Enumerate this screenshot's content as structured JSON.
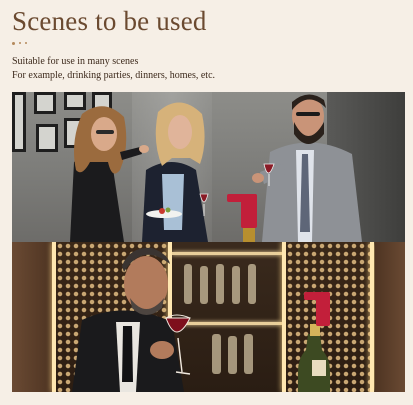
{
  "header": {
    "title": "Scenes to be used",
    "line1": "Suitable for use in many scenes",
    "line2": "For example, drinking parties, dinners, homes, etc."
  },
  "colors": {
    "background": "#f6efe6",
    "title": "#6b4a30",
    "body_text": "#3d2a1c",
    "accent_dots": "#b48a5c",
    "aerator_red": "#c21f3a"
  },
  "images": [
    {
      "name": "party-scene-photo",
      "depicts": "three people with wine glasses and a red wine aerator"
    },
    {
      "name": "wine-cellar-photo",
      "depicts": "man tasting red wine in a wine cellar with a red aerator on a bottle"
    }
  ]
}
